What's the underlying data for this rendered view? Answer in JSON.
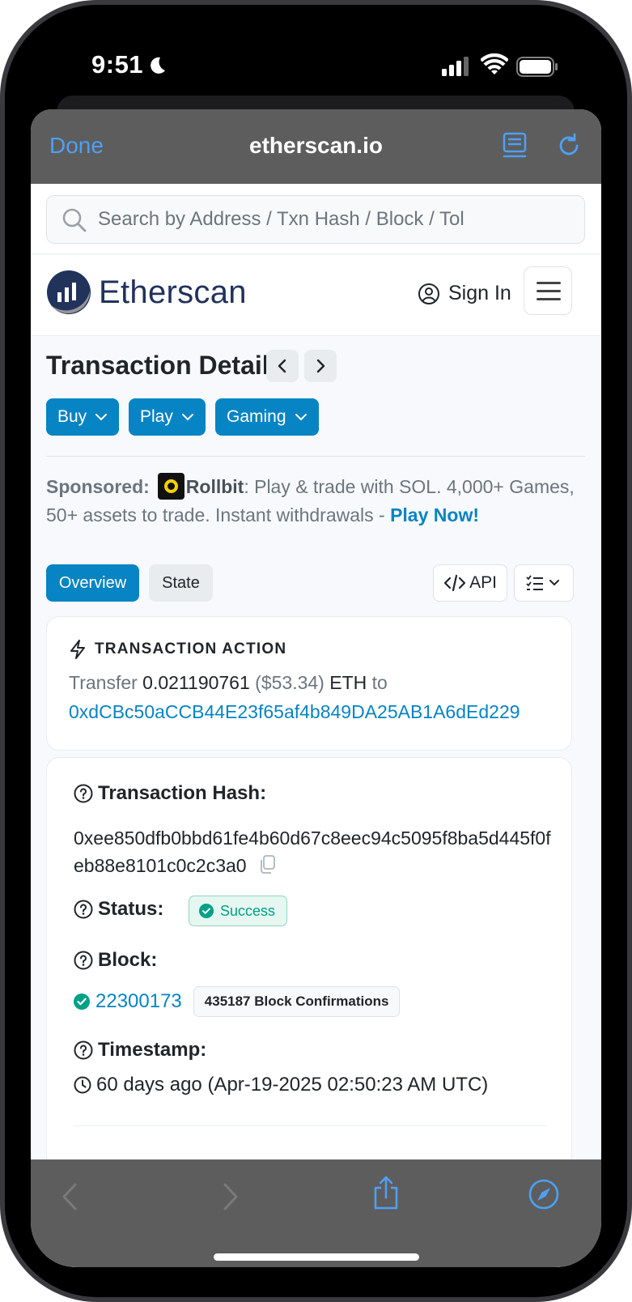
{
  "status_bar": {
    "time": "9:51"
  },
  "browser": {
    "done_label": "Done",
    "domain": "etherscan.io"
  },
  "search": {
    "placeholder": "Search by Address / Txn Hash / Block / Tol"
  },
  "header": {
    "logo_text": "Etherscan",
    "sign_in_label": "Sign In"
  },
  "page": {
    "title": "Transaction Details",
    "pills": [
      {
        "label": "Buy"
      },
      {
        "label": "Play"
      },
      {
        "label": "Gaming"
      }
    ]
  },
  "sponsored": {
    "prefix": "Sponsored:",
    "brand": "Rollbit",
    "text": ": Play & trade with SOL. 4,000+ Games, 50+ assets to trade. Instant withdrawals - ",
    "cta": "Play Now!"
  },
  "tabs": {
    "overview": "Overview",
    "state": "State",
    "api": "API"
  },
  "transaction_action": {
    "heading": "TRANSACTION ACTION",
    "verb": "Transfer",
    "amount": "0.021190761",
    "usd": "($53.34)",
    "unit": "ETH",
    "to_word": "to",
    "to_address": "0xdCBc50aCCB44E23f65af4b849DA25AB1A6dEd229"
  },
  "details": {
    "hash_label": "Transaction Hash:",
    "hash_value": "0xee850dfb0bbd61fe4b60d67c8eec94c5095f8ba5d445f0feb88e8101c0c2c3a0",
    "status_label": "Status:",
    "status_value": "Success",
    "block_label": "Block:",
    "block_value": "22300173",
    "block_confirmations": "435187 Block Confirmations",
    "timestamp_label": "Timestamp:",
    "timestamp_value": "60 days ago (Apr-19-2025 02:50:23 AM UTC)"
  },
  "colors": {
    "brand_blue": "#0784c3",
    "safari_blue": "#4ea0f5",
    "success_green": "#00a186",
    "toolbar_gray": "#5d5d5d"
  }
}
